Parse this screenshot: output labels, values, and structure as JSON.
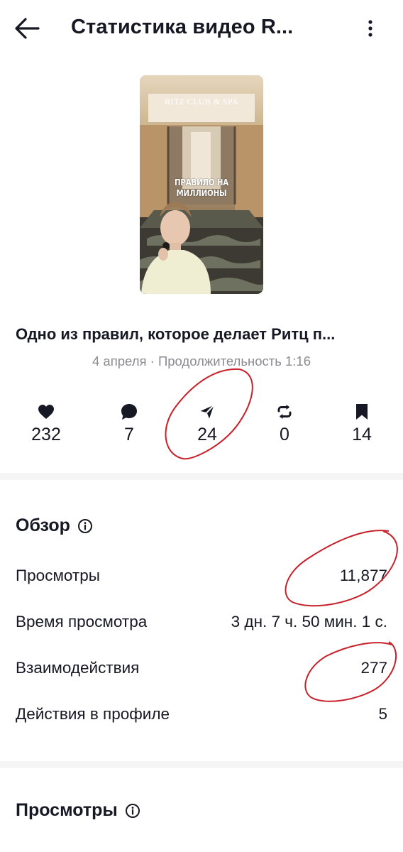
{
  "header": {
    "title": "Статистика видео R...",
    "back_icon": "arrow-left-icon",
    "more_icon": "more-vertical-icon"
  },
  "video": {
    "thumbnail_logo": "RITZ CLUB & SPA",
    "thumbnail_caption": "ПРАВИЛО НА МИЛЛИОНЫ",
    "title": "Одно из правил, которое делает Ритц п...",
    "meta": "4 апреля · Продолжительность 1:16"
  },
  "stats": [
    {
      "icon": "heart-icon",
      "value": "232"
    },
    {
      "icon": "comment-icon",
      "value": "7"
    },
    {
      "icon": "share-icon",
      "value": "24"
    },
    {
      "icon": "repost-icon",
      "value": "0"
    },
    {
      "icon": "bookmark-icon",
      "value": "14"
    }
  ],
  "overview": {
    "title": "Обзор",
    "rows": [
      {
        "label": "Просмотры",
        "value": "11,877"
      },
      {
        "label": "Время просмотра",
        "value": "3 дн. 7 ч. 50 мин. 1 с."
      },
      {
        "label": "Взаимодействия",
        "value": "277"
      },
      {
        "label": "Действия в профиле",
        "value": "5"
      }
    ]
  },
  "views_section": {
    "title": "Просмотры"
  },
  "colors": {
    "text": "#161823",
    "muted": "#8a8b91",
    "annotation": "#c8202a"
  }
}
